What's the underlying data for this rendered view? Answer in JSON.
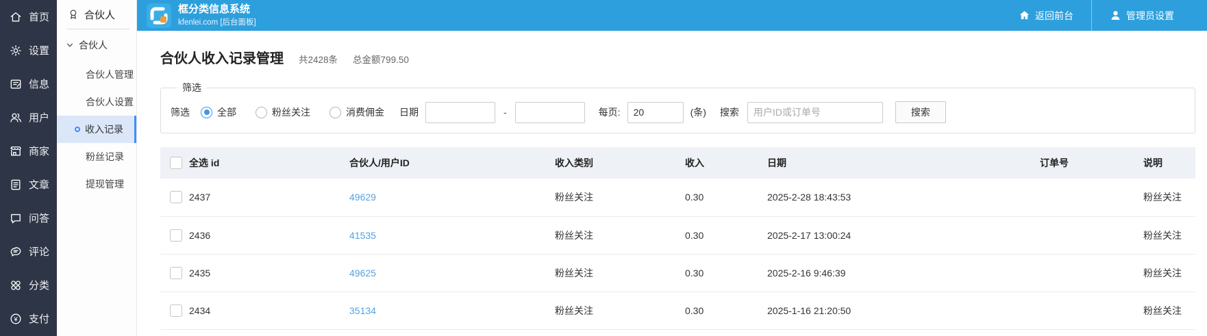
{
  "colors": {
    "topbar_blue": "#2d9fdd",
    "logo_tile_blue": "#3aade6",
    "logo_accent_orange": "#f29b38",
    "sidebar_dark": "#2e3546",
    "active_item_bg": "#dbe7f8",
    "accent_blue": "#3e8ef7",
    "link_blue": "#55a1e4",
    "table_header_bg": "#eef1f6"
  },
  "sidebar": {
    "items": [
      {
        "icon": "home-icon",
        "label": "首页"
      },
      {
        "icon": "gear-icon",
        "label": "设置"
      },
      {
        "icon": "message-icon",
        "label": "信息"
      },
      {
        "icon": "users-icon",
        "label": "用户"
      },
      {
        "icon": "store-icon",
        "label": "商家"
      },
      {
        "icon": "article-icon",
        "label": "文章"
      },
      {
        "icon": "qa-icon",
        "label": "问答"
      },
      {
        "icon": "comment-icon",
        "label": "评论"
      },
      {
        "icon": "category-icon",
        "label": "分类"
      },
      {
        "icon": "payment-icon",
        "label": "支付"
      }
    ]
  },
  "submenu": {
    "header": {
      "label": "合伙人"
    },
    "group": {
      "label": "合伙人"
    },
    "items": [
      {
        "label": "合伙人管理",
        "active": false
      },
      {
        "label": "合伙人设置",
        "active": false
      },
      {
        "label": "收入记录",
        "active": true
      },
      {
        "label": "粉丝记录",
        "active": false
      },
      {
        "label": "提现管理",
        "active": false
      }
    ]
  },
  "topbar": {
    "title": "框分类信息系统",
    "subtitle": "kfenlei.com [后台面板]",
    "link_front": "返回前台",
    "link_admin": "管理员设置"
  },
  "page": {
    "title": "合伙人收入记录管理",
    "count": "共2428条",
    "total": "总金额799.50"
  },
  "filter": {
    "legend": "筛选",
    "inline_label": "筛选",
    "radios": [
      {
        "label": "全部",
        "checked": true
      },
      {
        "label": "粉丝关注",
        "checked": false
      },
      {
        "label": "消费佣金",
        "checked": false
      }
    ],
    "date_label": "日期",
    "date_from": "",
    "date_to": "",
    "dash": "-",
    "per_page_label": "每页:",
    "per_page_value": "20",
    "per_page_unit": "(条)",
    "search_label": "搜索",
    "search_placeholder": "用户ID或订单号",
    "search_button": "搜索"
  },
  "table": {
    "headers": {
      "select_id": "全选 id",
      "user": "合伙人/用户ID",
      "category": "收入类别",
      "income": "收入",
      "date": "日期",
      "order": "订单号",
      "note": "说明"
    },
    "rows": [
      {
        "id": "2437",
        "user_id": "49629",
        "category": "粉丝关注",
        "income": "0.30",
        "date": "2025-2-28 18:43:53",
        "order": "",
        "note": "粉丝关注"
      },
      {
        "id": "2436",
        "user_id": "41535",
        "category": "粉丝关注",
        "income": "0.30",
        "date": "2025-2-17 13:00:24",
        "order": "",
        "note": "粉丝关注"
      },
      {
        "id": "2435",
        "user_id": "49625",
        "category": "粉丝关注",
        "income": "0.30",
        "date": "2025-2-16 9:46:39",
        "order": "",
        "note": "粉丝关注"
      },
      {
        "id": "2434",
        "user_id": "35134",
        "category": "粉丝关注",
        "income": "0.30",
        "date": "2025-1-16 21:20:50",
        "order": "",
        "note": "粉丝关注"
      }
    ]
  }
}
